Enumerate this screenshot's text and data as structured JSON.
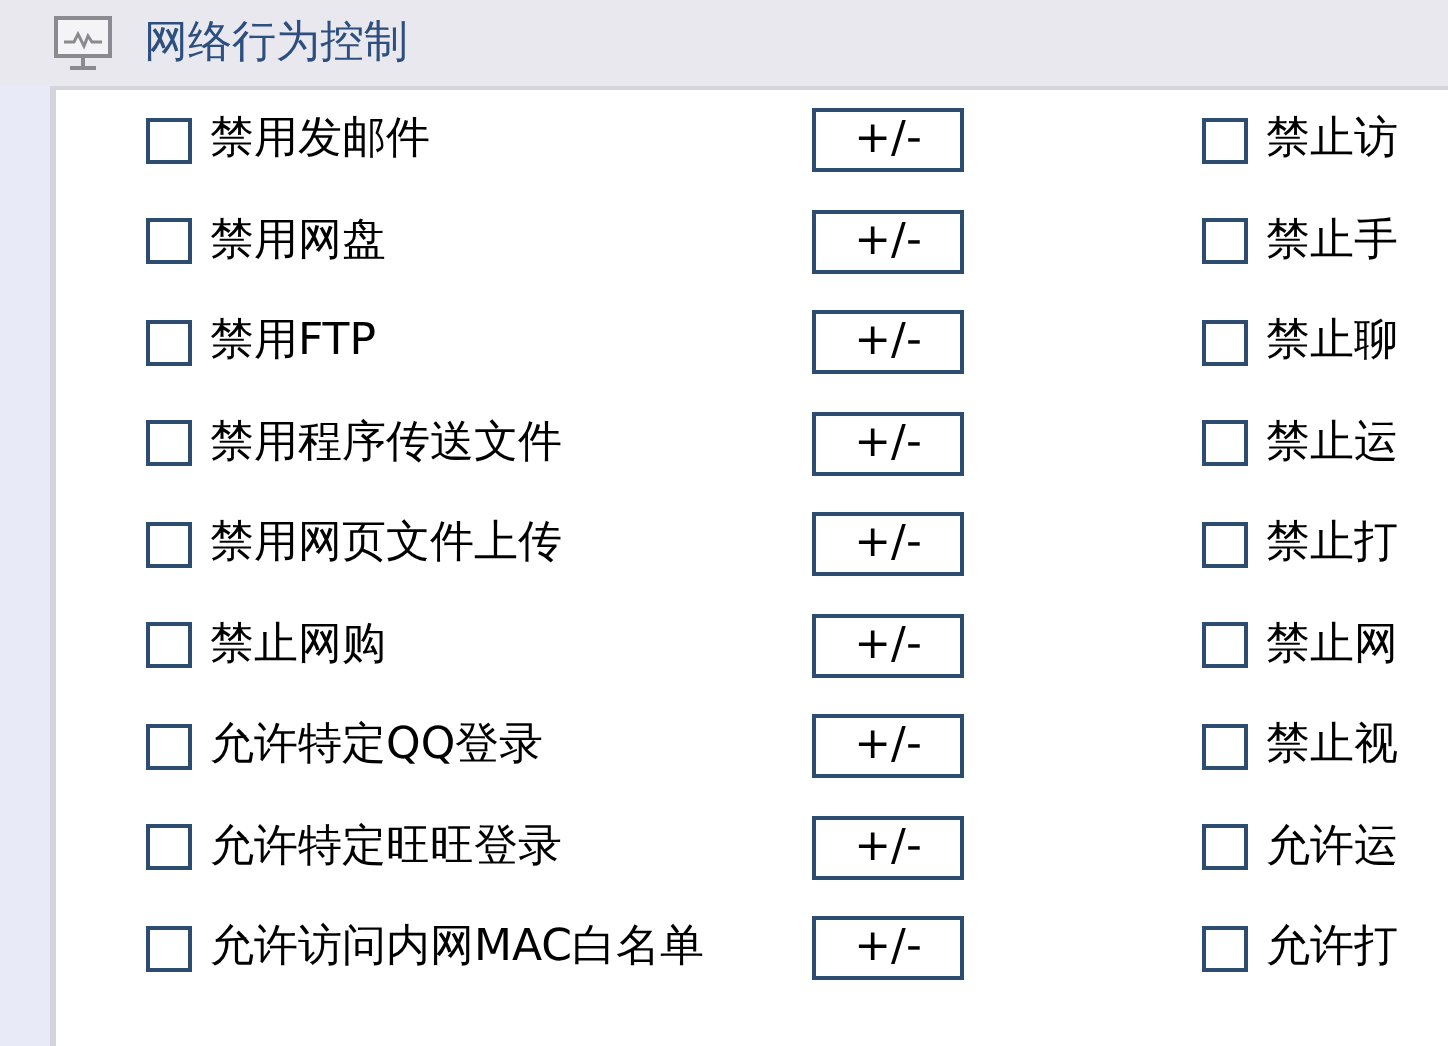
{
  "header": {
    "title": "网络行为控制"
  },
  "left_options": [
    {
      "label": "禁用发邮件",
      "checked": false,
      "button": "+/-"
    },
    {
      "label": "禁用网盘",
      "checked": false,
      "button": "+/-"
    },
    {
      "label": "禁用FTP",
      "checked": false,
      "button": "+/-"
    },
    {
      "label": "禁用程序传送文件",
      "checked": false,
      "button": "+/-"
    },
    {
      "label": "禁用网页文件上传",
      "checked": false,
      "button": "+/-"
    },
    {
      "label": "禁止网购",
      "checked": false,
      "button": "+/-"
    },
    {
      "label": "允许特定QQ登录",
      "checked": false,
      "button": "+/-"
    },
    {
      "label": "允许特定旺旺登录",
      "checked": false,
      "button": "+/-"
    },
    {
      "label": "允许访问内网MAC白名单",
      "checked": false,
      "button": "+/-"
    }
  ],
  "right_options": [
    {
      "label": "禁止访",
      "checked": false
    },
    {
      "label": "禁止手",
      "checked": false
    },
    {
      "label": "禁止聊",
      "checked": false
    },
    {
      "label": "禁止运",
      "checked": false
    },
    {
      "label": "禁止打",
      "checked": false
    },
    {
      "label": "禁止网",
      "checked": false
    },
    {
      "label": "禁止视",
      "checked": false
    },
    {
      "label": "允许运",
      "checked": false
    },
    {
      "label": "允许打",
      "checked": false
    }
  ]
}
